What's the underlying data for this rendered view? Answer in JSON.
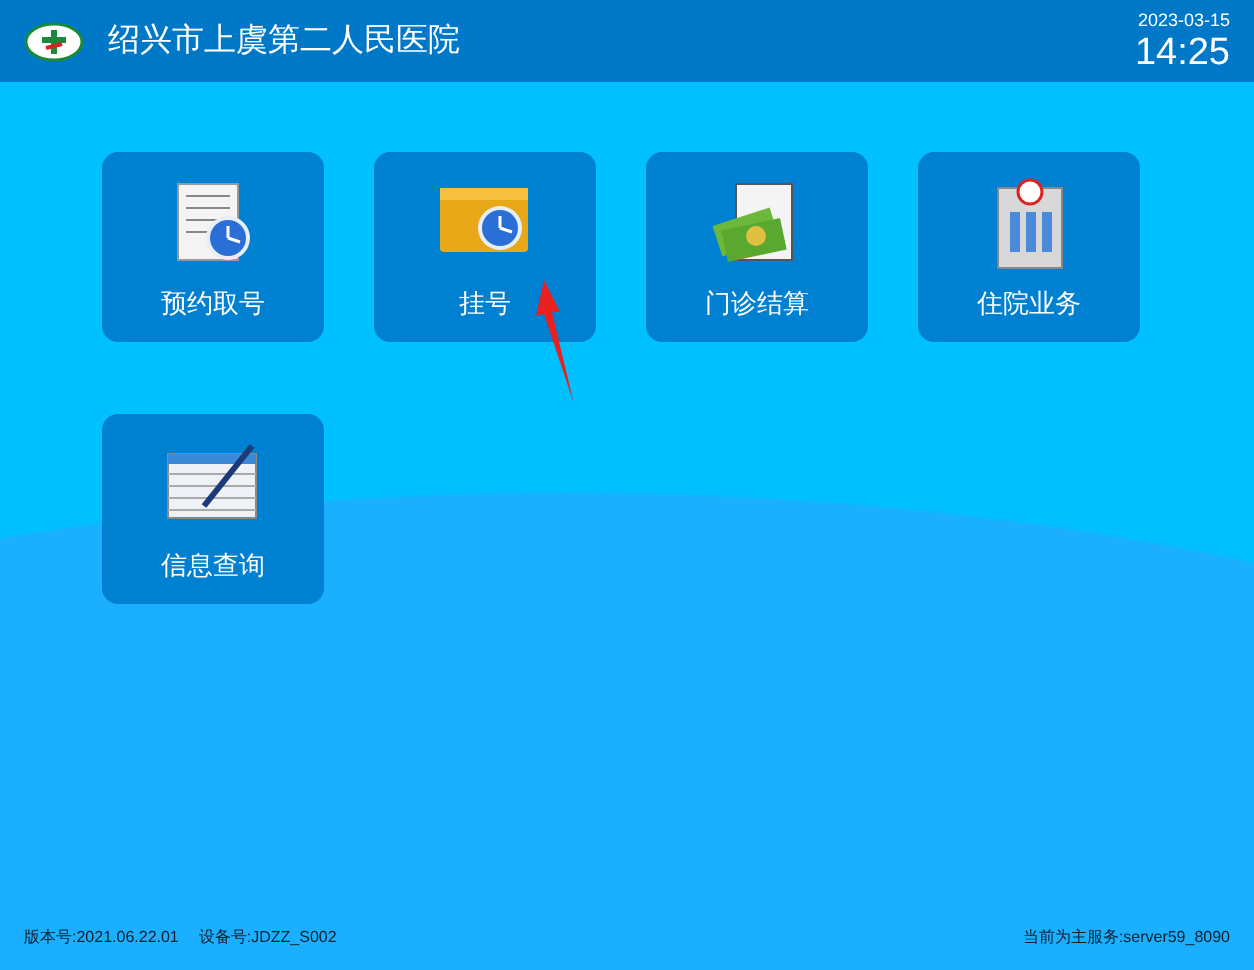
{
  "header": {
    "title": "绍兴市上虞第二人民医院",
    "date": "2023-03-15",
    "time": "14:25"
  },
  "tiles": [
    {
      "kind": "appointment",
      "label": "预约取号"
    },
    {
      "kind": "register",
      "label": "挂号"
    },
    {
      "kind": "billing",
      "label": "门诊结算"
    },
    {
      "kind": "inpatient",
      "label": "住院业务"
    },
    {
      "kind": "query",
      "label": "信息查询"
    }
  ],
  "footer": {
    "version": "版本号:2021.06.22.01",
    "device": "设备号:JDZZ_S002",
    "server": "当前为主服务:server59_8090"
  }
}
